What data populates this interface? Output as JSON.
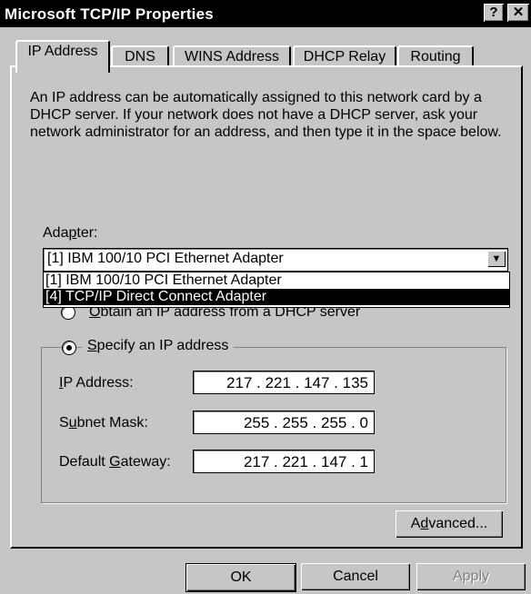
{
  "window": {
    "title": "Microsoft TCP/IP Properties",
    "help_button": "?",
    "close_button": "✕"
  },
  "tabs": [
    {
      "label": "IP Address",
      "active": true
    },
    {
      "label": "DNS"
    },
    {
      "label": "WINS Address"
    },
    {
      "label": "DHCP Relay"
    },
    {
      "label": "Routing"
    }
  ],
  "description": "An IP address can be automatically assigned to this network card by a DHCP server.  If your network does not have a DHCP server, ask your network administrator for an address, and then type it in the space below.",
  "adapter": {
    "label_pre": "Ada",
    "label_hot": "p",
    "label_post": "ter:",
    "selected": "[1] IBM 100/10 PCI Ethernet Adapter",
    "options": [
      "[1] IBM 100/10 PCI Ethernet Adapter",
      "[4] TCP/IP Direct Connect Adapter"
    ],
    "highlighted_index": 1
  },
  "radio_dhcp": {
    "hot": "O",
    "rest": "btain an IP address from a DHCP server"
  },
  "radio_specify": {
    "hot": "S",
    "rest": "pecify an IP address",
    "selected": true
  },
  "fields": {
    "ip_label_hot": "I",
    "ip_label_rest": "P Address:",
    "ip_value": "217 .  221  .  147  . 135",
    "subnet_label_pre": "S",
    "subnet_label_hot": "u",
    "subnet_label_post": "bnet Mask:",
    "subnet_value": "255 .  255  .  255  .   0",
    "gateway_label_pre": "Default ",
    "gateway_label_hot": "G",
    "gateway_label_post": "ateway:",
    "gateway_value": "217 .  221  .  147  .   1"
  },
  "advanced_button": {
    "pre": "A",
    "hot": "d",
    "post": "vanced..."
  },
  "footer": {
    "ok": "OK",
    "cancel": "Cancel",
    "apply": "Apply"
  }
}
